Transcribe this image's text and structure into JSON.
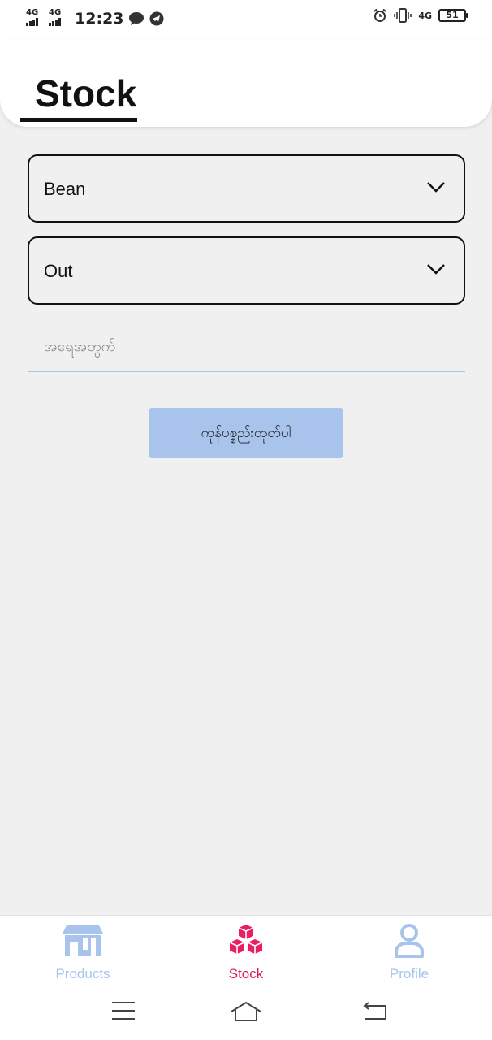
{
  "status_bar": {
    "time": "12:23",
    "network_1": "4G",
    "network_2": "4G",
    "network_3": "4G",
    "battery": "51"
  },
  "header": {
    "title": "Stock"
  },
  "form": {
    "product_select": {
      "value": "Bean"
    },
    "type_select": {
      "value": "Out"
    },
    "quantity_input": {
      "placeholder": "အရေအတွက်",
      "value": ""
    },
    "submit_label": "ကုန်ပစ္စည်းထုတ်ပါ"
  },
  "bottom_nav": {
    "items": [
      {
        "label": "Products",
        "icon": "store-icon",
        "active": false
      },
      {
        "label": "Stock",
        "icon": "boxes-icon",
        "active": true
      },
      {
        "label": "Profile",
        "icon": "person-icon",
        "active": false
      }
    ]
  },
  "colors": {
    "accent": "#e91e63",
    "inactive": "#a8c4ed",
    "button": "#a8c4ed",
    "background": "#f0f0f0"
  }
}
